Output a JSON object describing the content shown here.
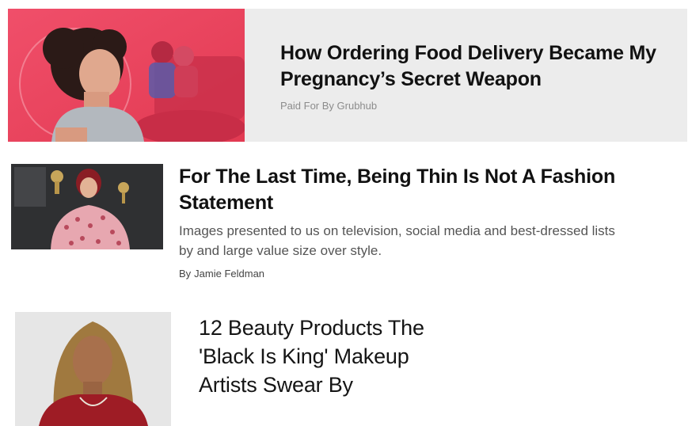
{
  "sponsored": {
    "headline": "How Ordering Food Delivery Became My Pregnancy’s Secret Weapon",
    "sponsor_label": "Paid For By Grubhub"
  },
  "articles": [
    {
      "headline": "For The Last Time, Being Thin Is Not A Fashion Statement",
      "summary_line_1": "Images presented to us on television, social media and best-dressed lists",
      "summary_line_2": "by and large value size over style.",
      "byline_prefix": "By",
      "author": "Jamie Feldman"
    },
    {
      "headline": "12 Beauty Products The 'Black Is King' Makeup Artists Swear By"
    }
  ],
  "colors": {
    "sponsored_bg": "#ececec",
    "promo_pink": "#e8455e"
  }
}
